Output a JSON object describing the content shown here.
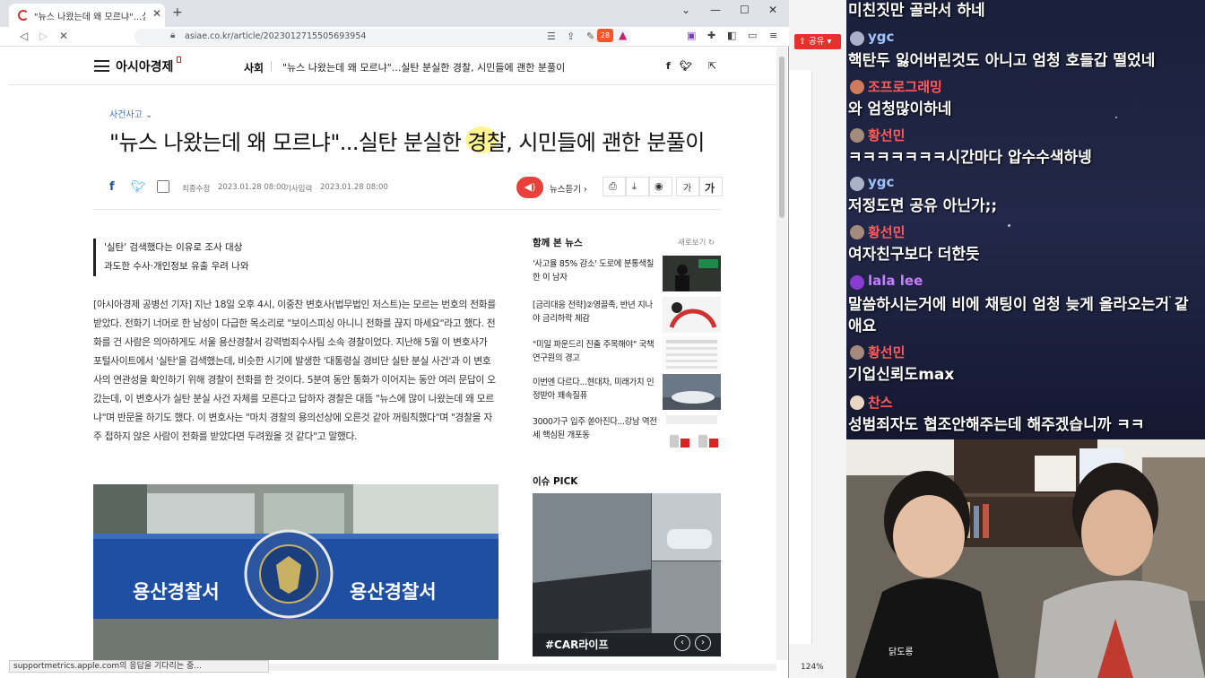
{
  "browser": {
    "tab_title": "\"뉴스 나왔는데 왜 모르냐\"...실탄",
    "url": "asiae.co.kr/article/2023012715505693954",
    "brave_count": "28",
    "status_text": "supportmetrics.apple.com의 응답을 기다리는 중...",
    "zoom": "124%"
  },
  "site": {
    "logo": "아시아경제",
    "section": "사회",
    "header_title": "\"뉴스 나왔는데 왜 모르냐\"...실탄 분실한 경찰, 시민들에 괜한 분풀이"
  },
  "article": {
    "category": "사건사고",
    "headline": "\"뉴스 나왔는데 왜 모르냐\"...실탄 분실한 경찰, 시민들에 괜한 분풀이",
    "updated_label": "최종수정",
    "updated": "2023.01.28 08:00",
    "published_label": "기사입력",
    "published": "2023.01.28 08:00",
    "tts_label": "뉴스듣기",
    "font_small": "가",
    "font_large": "가",
    "summary": [
      "'실탄' 검색했다는 이유로 조사 대상",
      "과도한 수사·개인정보 유출 우려 나와"
    ],
    "body": "[아시아경제 공병선 기자] 지난 18일 오후 4시, 이중찬 변호사(법무법인 저스트)는 모르는 번호의 전화를 받았다. 전화기 너머로 한 남성이 다급한 목소리로 \"보이스피싱 아니니 전화를 끊지 마세요\"라고 했다. 전화를 건 사람은 의아하게도 서울 용산경찰서 강력범죄수사팀 소속 경찰이었다. 지난해 5월 이 변호사가 포털사이트에서 '실탄'을 검색했는데, 비슷한 시기에 발생한 '대통령실 경비단 실탄 분실 사건'과 이 변호사의 연관성을 확인하기 위해 경찰이 전화를 한 것이다. 5분여 동안 통화가 이어지는 동안 여러 문답이 오갔는데, 이 변호사가 실탄 분실 사건 자체를 모른다고 답하자 경찰은 대뜸 \"뉴스에 많이 나왔는데 왜 모르냐\"며 반문을 하기도 했다. 이 변호사는 \"마치 경찰의 용의선상에 오른것 같아 꺼림칙했다\"며 \"경찰을 자주 접하지 않은 사람이 전화를 받았다면 두려웠을 것 같다\"고 말했다.",
    "photo_sign_left": "용산경찰서",
    "photo_sign_right": "용산경찰서"
  },
  "sidebar": {
    "title": "함께 본 뉴스",
    "refresh": "새로보기",
    "items": [
      {
        "text": "'사고율 85% 감소' 도로에 분통색칠한 이 남자"
      },
      {
        "text": "[금리대응 전략]②영끌족, 반년 지나야 금리하락 체감"
      },
      {
        "text": "\"미일 파운드리 진출 주목해야\" 국책연구원의 경고"
      },
      {
        "text": "이번엔 다르다...현대차, 미래가치 인정받아 꽤속질퓨"
      },
      {
        "text": "3000가구 입주 쏟아진다...강남 역전세 핵심된 개포동"
      }
    ],
    "issue_title": "이슈 PICK",
    "issue_label": "#CAR라이프"
  },
  "overlay": {
    "share_label": "공유"
  },
  "chat": {
    "messages": [
      {
        "user": "",
        "text": "미친짓만 골라서 하네",
        "color": "#ffffff"
      },
      {
        "user": "ygc",
        "text": "핵탄두 잃어버린것도 아니고 엄청 호들갑 떨었네",
        "color": "#9fc5ff"
      },
      {
        "user": "조프로그래밍",
        "text": "와 엄청많이하네",
        "color": "#ff5a5a"
      },
      {
        "user": "황선민",
        "text": "ㅋㅋㅋㅋㅋㅋㅋ시간마다 압수수색하넹",
        "color": "#ff5a5a"
      },
      {
        "user": "ygc",
        "text": "저정도면 공유 아닌가;;",
        "color": "#9fc5ff"
      },
      {
        "user": "황선민",
        "text": "여자친구보다 더한듯",
        "color": "#ff5a5a"
      },
      {
        "user": "lala lee",
        "text": "말씀하시는거에 비에 채팅이 엄청 늦게 올라오는거 같",
        "text2": "애요",
        "color": "#c77dff"
      },
      {
        "user": "황선민",
        "text": "기업신뢰도max",
        "color": "#ff5a5a"
      },
      {
        "user": "찬스",
        "text": "성범죄자도 협조안해주는데 해주겠습니까 ㅋㅋ",
        "color": "#ff5a5a"
      }
    ]
  },
  "cam": {
    "shirt_text": "닭도롱"
  }
}
